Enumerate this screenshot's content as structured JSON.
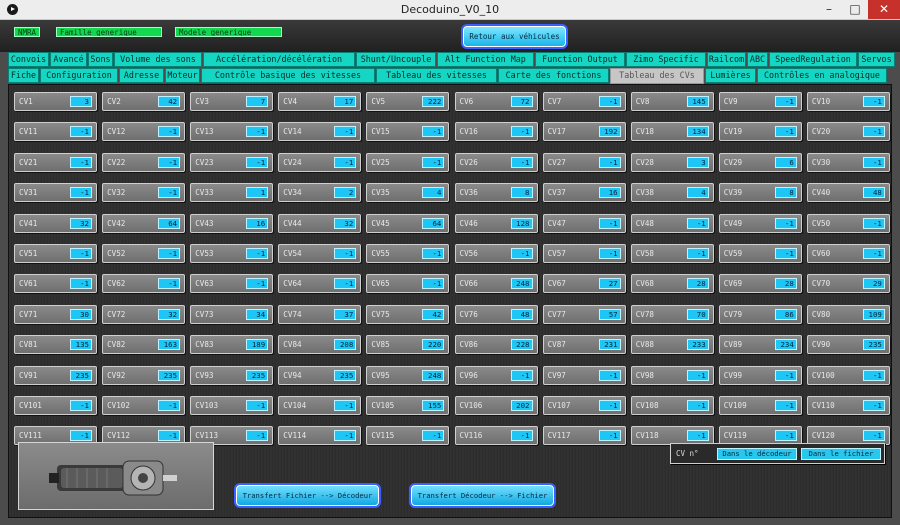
{
  "window": {
    "title": "Decoduino_V0_10",
    "min": "–",
    "max": "□",
    "close": "✕"
  },
  "header": {
    "badges": [
      "NMRA",
      "Famille_generique",
      "Modele_generique"
    ],
    "back_button": "Retour aux véhicules"
  },
  "tabs_row1": [
    {
      "label": "Convois"
    },
    {
      "label": "Avancé"
    },
    {
      "label": "Sons"
    },
    {
      "label": "Volume des sons"
    },
    {
      "label": "Accélération/décélération"
    },
    {
      "label": "Shunt/Uncouple"
    },
    {
      "label": "Alt Function Map"
    },
    {
      "label": "Function Output"
    },
    {
      "label": "Zimo Specific"
    },
    {
      "label": "Railcom"
    },
    {
      "label": "ABC"
    },
    {
      "label": "SpeedRegulation"
    },
    {
      "label": "Servos"
    }
  ],
  "tabs_row2": [
    {
      "label": "Fiche"
    },
    {
      "label": "Configuration"
    },
    {
      "label": "Adresse"
    },
    {
      "label": "Moteur"
    },
    {
      "label": "Contrôle basique des vitesses"
    },
    {
      "label": "Tableau des vitesses"
    },
    {
      "label": "Carte des fonctions"
    },
    {
      "label": "Tableau des CVs"
    },
    {
      "label": "Lumières"
    },
    {
      "label": "Contrôles en analogique"
    }
  ],
  "active_tab": "Tableau des CVs",
  "cv_values": [
    "3",
    "42",
    "7",
    "17",
    "222",
    "72",
    "-1",
    "145",
    "-1",
    "-1",
    "-1",
    "-1",
    "-1",
    "-1",
    "-1",
    "-1",
    "192",
    "134",
    "-1",
    "-1",
    "-1",
    "-1",
    "-1",
    "-1",
    "-1",
    "-1",
    "-1",
    "3",
    "6",
    "-1",
    "-1",
    "-1",
    "1",
    "2",
    "4",
    "8",
    "16",
    "4",
    "8",
    "48",
    "32",
    "64",
    "16",
    "32",
    "64",
    "128",
    "-1",
    "-1",
    "-1",
    "-1",
    "-1",
    "-1",
    "-1",
    "-1",
    "-1",
    "-1",
    "-1",
    "-1",
    "-1",
    "-1",
    "-1",
    "-1",
    "-1",
    "-1",
    "-1",
    "248",
    "27",
    "28",
    "28",
    "29",
    "30",
    "32",
    "34",
    "37",
    "42",
    "48",
    "57",
    "70",
    "86",
    "109",
    "135",
    "163",
    "189",
    "208",
    "220",
    "228",
    "231",
    "233",
    "234",
    "235",
    "235",
    "235",
    "235",
    "235",
    "248",
    "-1",
    "-1",
    "-1",
    "-1",
    "-1",
    "-1",
    "-1",
    "-1",
    "-1",
    "155",
    "202",
    "-1",
    "-1",
    "-1",
    "-1",
    "-1",
    "-1",
    "-1",
    "-1",
    "-1",
    "-1",
    "-1",
    "-1",
    "-1",
    "-1"
  ],
  "cv_panel": {
    "label": "CV n°",
    "btn_decoder": "Dans le décodeur",
    "btn_file": "Dans le fichier"
  },
  "transfer": {
    "file_to_decoder": "Transfert Fichier --> Décodeur",
    "decoder_to_file": "Transfert Décodeur --> Fichier"
  },
  "colors": {
    "tab": "#15d6c3",
    "value": "#1dc6f4",
    "badge": "#12d850",
    "close": "#c7312b"
  }
}
